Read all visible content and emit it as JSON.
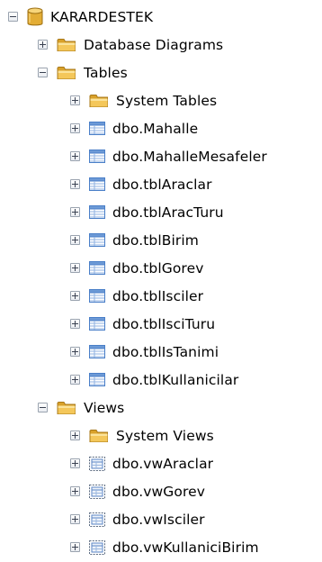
{
  "tree": {
    "root": {
      "label": "KARARDESTEK",
      "icon": "database-icon"
    },
    "database_diagrams": {
      "label": "Database Diagrams",
      "icon": "folder-icon"
    },
    "tables": {
      "label": "Tables",
      "icon": "folder-icon",
      "items": [
        {
          "label": "System Tables",
          "icon": "folder-icon"
        },
        {
          "label": "dbo.Mahalle",
          "icon": "table-icon"
        },
        {
          "label": "dbo.MahalleMesafeler",
          "icon": "table-icon"
        },
        {
          "label": "dbo.tblAraclar",
          "icon": "table-icon"
        },
        {
          "label": "dbo.tblAracTuru",
          "icon": "table-icon"
        },
        {
          "label": "dbo.tblBirim",
          "icon": "table-icon"
        },
        {
          "label": "dbo.tblGorev",
          "icon": "table-icon"
        },
        {
          "label": "dbo.tblIsciler",
          "icon": "table-icon"
        },
        {
          "label": "dbo.tblIsciTuru",
          "icon": "table-icon"
        },
        {
          "label": "dbo.tblIsTanimi",
          "icon": "table-icon"
        },
        {
          "label": "dbo.tblKullanicilar",
          "icon": "table-icon"
        }
      ]
    },
    "views": {
      "label": "Views",
      "icon": "folder-icon",
      "items": [
        {
          "label": "System Views",
          "icon": "folder-icon"
        },
        {
          "label": "dbo.vwAraclar",
          "icon": "view-icon"
        },
        {
          "label": "dbo.vwGorev",
          "icon": "view-icon"
        },
        {
          "label": "dbo.vwIsciler",
          "icon": "view-icon"
        },
        {
          "label": "dbo.vwKullaniciBirim",
          "icon": "view-icon"
        }
      ]
    }
  },
  "colors": {
    "folder": "#e8b73e",
    "folder_light": "#f9df86",
    "table": "#4a7fc8",
    "database": "#d9a12a",
    "expander_border": "#9aa3af"
  }
}
